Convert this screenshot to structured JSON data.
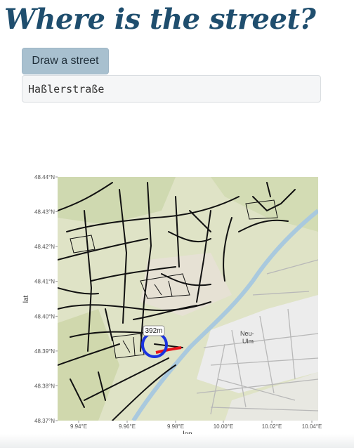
{
  "page": {
    "title": "Where is the street?"
  },
  "controls": {
    "draw_button_label": "Draw a street",
    "street_name": "Haßlerstraße"
  },
  "map": {
    "y_axis_title": "lat",
    "x_axis_title": "lon",
    "x_ticks": [
      "9.94°E",
      "9.96°E",
      "9.98°E",
      "10.00°E",
      "10.02°E",
      "10.04°E"
    ],
    "y_ticks": [
      "48.44°N",
      "48.43°N",
      "48.42°N",
      "48.41°N",
      "48.40°N",
      "48.39°N",
      "48.38°N",
      "48.37°N"
    ],
    "distance_label": "392m",
    "place_label_1": "Neu-",
    "place_label_2": "Ulm",
    "colors": {
      "street_highlight": "#e8141b",
      "circle": "#1a33e0"
    }
  }
}
